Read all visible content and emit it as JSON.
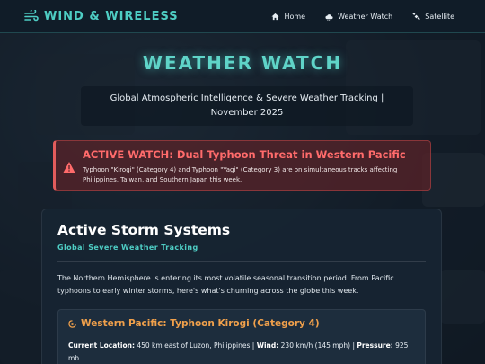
{
  "brand": {
    "name": "WIND & WIRELESS",
    "icon": "wind-icon",
    "accent": "#4ecdc4"
  },
  "nav": {
    "items": [
      {
        "label": "Home",
        "icon": "home-icon"
      },
      {
        "label": "Weather Watch",
        "icon": "cloud-icon"
      },
      {
        "label": "Satellite",
        "icon": "satellite-icon"
      }
    ]
  },
  "hero": {
    "title": "WEATHER WATCH",
    "subtitle": "Global Atmospheric Intelligence & Severe Weather Tracking | November 2025"
  },
  "alert": {
    "icon": "warning-icon",
    "title": "ACTIVE WATCH: Dual Typhoon Threat in Western Pacific",
    "text": "Typhoon \"Kirogi\" (Category 4) and Typhoon \"Yagi\" (Category 3) are on simultaneous tracks affecting Philippines, Taiwan, and Southern Japan this week.",
    "color": "#ff6b6b"
  },
  "section": {
    "title": "Active Storm Systems",
    "subtitle": "Global Severe Weather Tracking",
    "intro": "The Northern Hemisphere is entering its most volatile seasonal transition period. From Pacific typhoons to early winter storms, here's what's churning across the globe this week."
  },
  "storm": {
    "icon": "cyclone-icon",
    "title": "Western Pacific: Typhoon Kirogi (Category 4)",
    "location_label": "Current Location:",
    "location_value": "450 km east of Luzon, Philippines",
    "sep1": "|",
    "wind_label": "Wind:",
    "wind_value": "230 km/h (145 mph)",
    "sep2": "|",
    "pressure_label": "Pressure:",
    "pressure_value": "925 mb",
    "color": "#f0a04b"
  }
}
